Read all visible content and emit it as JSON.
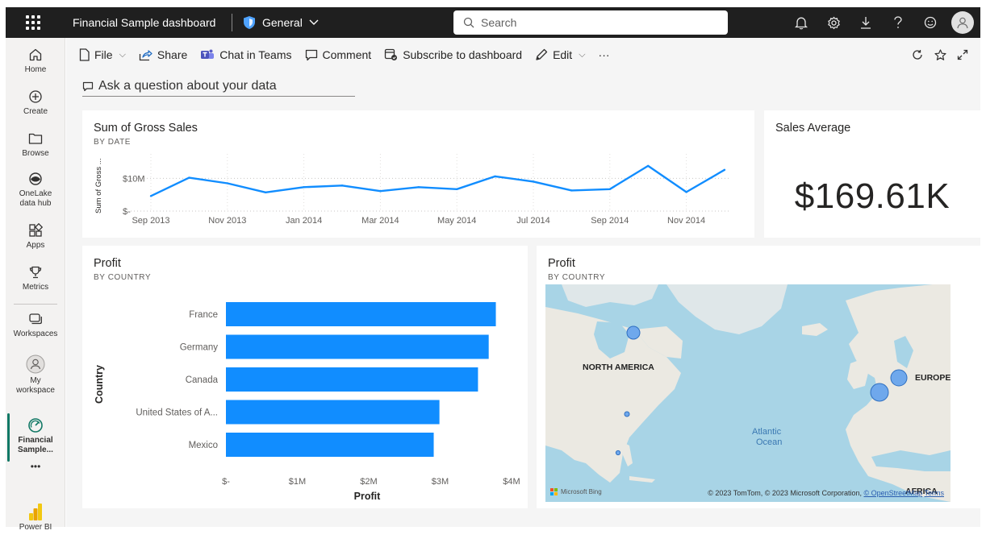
{
  "topbar": {
    "title": "Financial Sample dashboard",
    "sensitivity": "General",
    "search_placeholder": "Search"
  },
  "nav": {
    "home": "Home",
    "create": "Create",
    "browse": "Browse",
    "onelake_1": "OneLake",
    "onelake_2": "data hub",
    "apps": "Apps",
    "metrics": "Metrics",
    "workspaces": "Workspaces",
    "my_workspace_1": "My",
    "my_workspace_2": "workspace",
    "active_1": "Financial",
    "active_2": "Sample...",
    "more": "•••",
    "powerbi": "Power BI"
  },
  "commands": {
    "file": "File",
    "share": "Share",
    "chat": "Chat in Teams",
    "comment": "Comment",
    "subscribe": "Subscribe to dashboard",
    "edit": "Edit",
    "more": "···"
  },
  "qa": {
    "placeholder": "Ask a question about your data"
  },
  "tiles": {
    "gross_sales": {
      "title": "Sum of Gross Sales",
      "subtitle": "BY DATE"
    },
    "sales_avg": {
      "title": "Sales Average",
      "value": "$169.61K"
    },
    "profit_bar": {
      "title": "Profit",
      "subtitle": "BY COUNTRY"
    },
    "profit_map": {
      "title": "Profit",
      "subtitle": "BY COUNTRY"
    }
  },
  "map": {
    "labels": {
      "north_america": "NORTH AMERICA",
      "europe": "EUROPE",
      "atlantic_1": "Atlantic",
      "atlantic_2": "Ocean",
      "africa": "AFRICA"
    },
    "attribution": "© 2023 TomTom, © 2023 Microsoft Corporation,",
    "osm": "© OpenStreetMap",
    "terms": "Terms",
    "logo": "Microsoft Bing"
  },
  "chart_data": [
    {
      "type": "line",
      "title": "Sum of Gross Sales",
      "subtitle": "BY DATE",
      "ylabel": "Sum of Gross ...",
      "x": [
        "2013-09",
        "2013-10",
        "2013-11",
        "2013-12",
        "2014-01",
        "2014-02",
        "2014-03",
        "2014-04",
        "2014-05",
        "2014-06",
        "2014-07",
        "2014-08",
        "2014-09",
        "2014-10",
        "2014-11",
        "2014-12"
      ],
      "x_tick_labels": [
        "Sep 2013",
        "Nov 2013",
        "Jan 2014",
        "Mar 2014",
        "May 2014",
        "Jul 2014",
        "Sep 2014",
        "Nov 2014"
      ],
      "y_tick_labels": [
        "$-",
        "$10M"
      ],
      "values": [
        4.6,
        10.2,
        8.5,
        5.7,
        7.3,
        7.8,
        6.1,
        7.3,
        6.7,
        10.6,
        9.0,
        6.3,
        6.7,
        13.8,
        5.8,
        12.6
      ],
      "color": "#118dff",
      "y_units": "$M",
      "grid": true
    },
    {
      "type": "bar",
      "orientation": "horizontal",
      "title": "Profit",
      "subtitle": "BY COUNTRY",
      "categories": [
        "France",
        "Germany",
        "Canada",
        "United States of A...",
        "Mexico"
      ],
      "values": [
        3.78,
        3.68,
        3.53,
        2.99,
        2.91
      ],
      "value_units": "$M",
      "xlabel": "Profit",
      "ylabel": "Country",
      "x_ticks": [
        0,
        1,
        2,
        3,
        4
      ],
      "x_tick_labels": [
        "$-",
        "$1M",
        "$2M",
        "$3M",
        "$4M"
      ],
      "color": "#118dff"
    }
  ]
}
